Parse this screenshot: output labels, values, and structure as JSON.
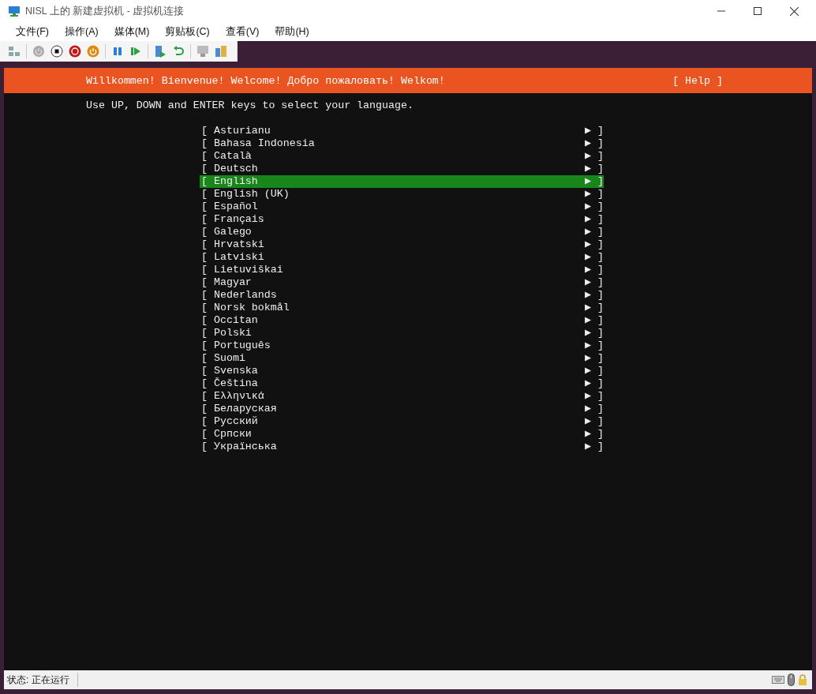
{
  "window": {
    "title": "NISL 上的 新建虚拟机 - 虚拟机连接"
  },
  "menu": [
    "文件(F)",
    "操作(A)",
    "媒体(M)",
    "剪贴板(C)",
    "查看(V)",
    "帮助(H)"
  ],
  "installer": {
    "header": "Willkommen! Bienvenue! Welcome! Добро пожаловать! Welkom!",
    "help": "[ Help ]",
    "instruction": "Use UP, DOWN and ENTER keys to select your language.",
    "languages": [
      {
        "prefix": "[",
        "label": "Asturianu",
        "suffix": "▶ ]",
        "selected": false
      },
      {
        "prefix": "[",
        "label": "Bahasa Indonesia",
        "suffix": "▶ ]",
        "selected": false
      },
      {
        "prefix": "[",
        "label": "Català",
        "suffix": "▶ ]",
        "selected": false
      },
      {
        "prefix": "[",
        "label": "Deutsch",
        "suffix": "▶ ]",
        "selected": false
      },
      {
        "prefix": "[",
        "label": "English",
        "suffix": "▶ ]",
        "selected": true
      },
      {
        "prefix": "[",
        "label": "English (UK)",
        "suffix": "▶ ]",
        "selected": false
      },
      {
        "prefix": "[",
        "label": "Español",
        "suffix": "▶ ]",
        "selected": false
      },
      {
        "prefix": "[",
        "label": "Français",
        "suffix": "▶ ]",
        "selected": false
      },
      {
        "prefix": "[",
        "label": "Galego",
        "suffix": "▶ ]",
        "selected": false
      },
      {
        "prefix": "[",
        "label": "Hrvatski",
        "suffix": "▶ ]",
        "selected": false
      },
      {
        "prefix": "[",
        "label": "Latviski",
        "suffix": "▶ ]",
        "selected": false
      },
      {
        "prefix": "[",
        "label": "Lietuviškai",
        "suffix": "▶ ]",
        "selected": false
      },
      {
        "prefix": "[",
        "label": "Magyar",
        "suffix": "▶ ]",
        "selected": false
      },
      {
        "prefix": "[",
        "label": "Nederlands",
        "suffix": "▶ ]",
        "selected": false
      },
      {
        "prefix": "[",
        "label": "Norsk bokmål",
        "suffix": "▶ ]",
        "selected": false
      },
      {
        "prefix": "[",
        "label": "Occitan",
        "suffix": "▶ ]",
        "selected": false
      },
      {
        "prefix": "[",
        "label": "Polski",
        "suffix": "▶ ]",
        "selected": false
      },
      {
        "prefix": "[",
        "label": "Português",
        "suffix": "▶ ]",
        "selected": false
      },
      {
        "prefix": "[",
        "label": "Suomi",
        "suffix": "▶ ]",
        "selected": false
      },
      {
        "prefix": "[",
        "label": "Svenska",
        "suffix": "▶ ]",
        "selected": false
      },
      {
        "prefix": "[",
        "label": "Čeština",
        "suffix": "▶ ]",
        "selected": false
      },
      {
        "prefix": "[",
        "label": "Ελληνικά",
        "suffix": "▶ ]",
        "selected": false
      },
      {
        "prefix": "[",
        "label": "Беларуская",
        "suffix": "▶ ]",
        "selected": false
      },
      {
        "prefix": "[",
        "label": "Русский",
        "suffix": "▶ ]",
        "selected": false
      },
      {
        "prefix": "[",
        "label": "Српски",
        "suffix": "▶ ]",
        "selected": false
      },
      {
        "prefix": "[",
        "label": "Українська",
        "suffix": "▶ ]",
        "selected": false
      }
    ]
  },
  "status_bar": {
    "status": "状态: 正在运行"
  }
}
